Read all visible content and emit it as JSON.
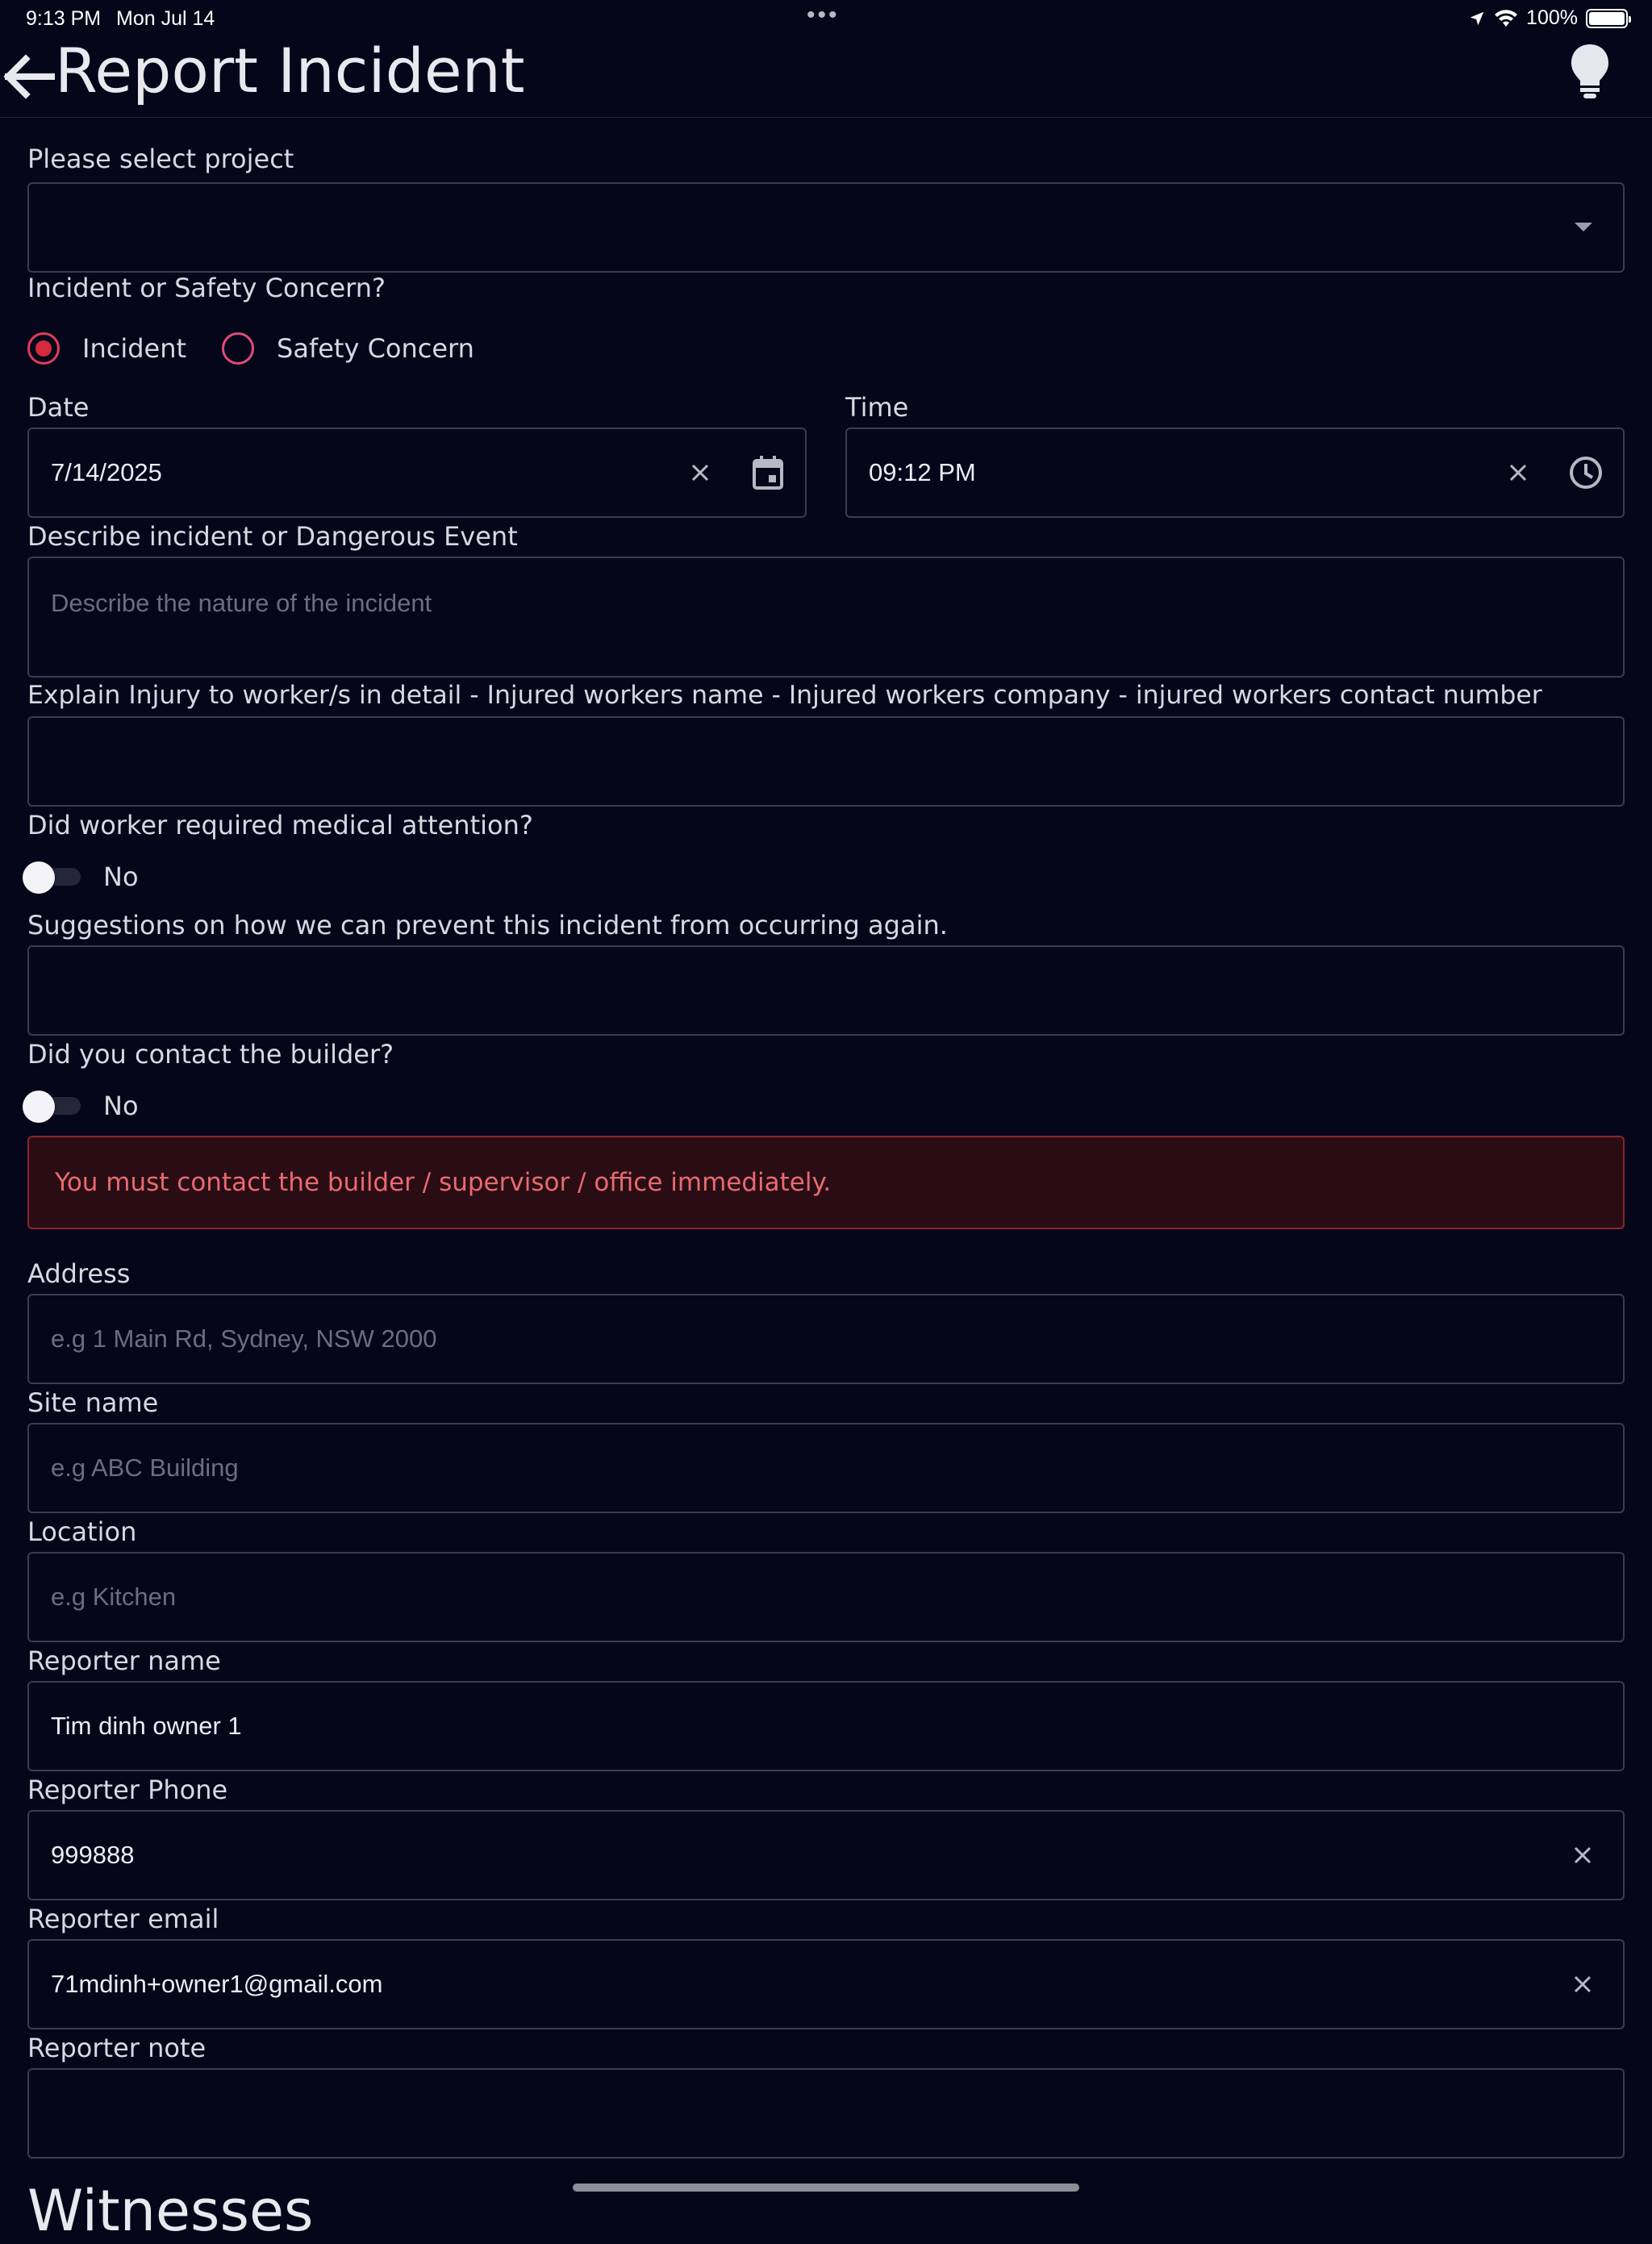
{
  "status_bar": {
    "time": "9:13 PM",
    "date": "Mon Jul 14",
    "battery": "100%"
  },
  "header": {
    "title": "Report Incident"
  },
  "project": {
    "label": "Please select project",
    "value": ""
  },
  "type_question": {
    "label": "Incident or Safety Concern?",
    "options": [
      "Incident",
      "Safety Concern"
    ],
    "selected": "Incident"
  },
  "date": {
    "label": "Date",
    "value": "7/14/2025"
  },
  "time": {
    "label": "Time",
    "value": "09:12 PM"
  },
  "describe": {
    "label": "Describe incident or Dangerous Event",
    "placeholder": "Describe the nature of the incident"
  },
  "injury": {
    "label": "Explain Injury to worker/s in detail - Injured workers name - Injured workers company - injured workers contact number",
    "value": ""
  },
  "medical": {
    "label": "Did worker required medical attention?",
    "toggle_text": "No"
  },
  "suggestions": {
    "label": "Suggestions on how we can prevent this incident from occurring again.",
    "value": ""
  },
  "builder": {
    "label": "Did you contact the builder?",
    "toggle_text": "No",
    "alert": "You must contact the builder / supervisor / office immediately."
  },
  "address": {
    "label": "Address",
    "placeholder": "e.g 1 Main Rd, Sydney, NSW 2000"
  },
  "site_name": {
    "label": "Site name",
    "placeholder": "e.g ABC Building"
  },
  "location": {
    "label": "Location",
    "placeholder": "e.g Kitchen"
  },
  "reporter_name": {
    "label": "Reporter name",
    "value": "Tim dinh owner 1"
  },
  "reporter_phone": {
    "label": "Reporter Phone",
    "value": "999888"
  },
  "reporter_email": {
    "label": "Reporter email",
    "value": "71mdinh+owner1@gmail.com"
  },
  "reporter_note": {
    "label": "Reporter note",
    "value": ""
  },
  "next_section": {
    "title": "Witnesses"
  },
  "colors": {
    "background": "#05061a",
    "field_border": "#3a3c52",
    "radio_accent": "#d42a3f",
    "alert_bg": "#2a0d14",
    "alert_text": "#e86a72"
  },
  "icons": [
    "arrow-back-icon",
    "lightbulb-icon",
    "dropdown-caret-icon",
    "clear-icon",
    "calendar-icon",
    "clock-icon",
    "location-arrow-icon",
    "wifi-icon",
    "battery-icon"
  ]
}
